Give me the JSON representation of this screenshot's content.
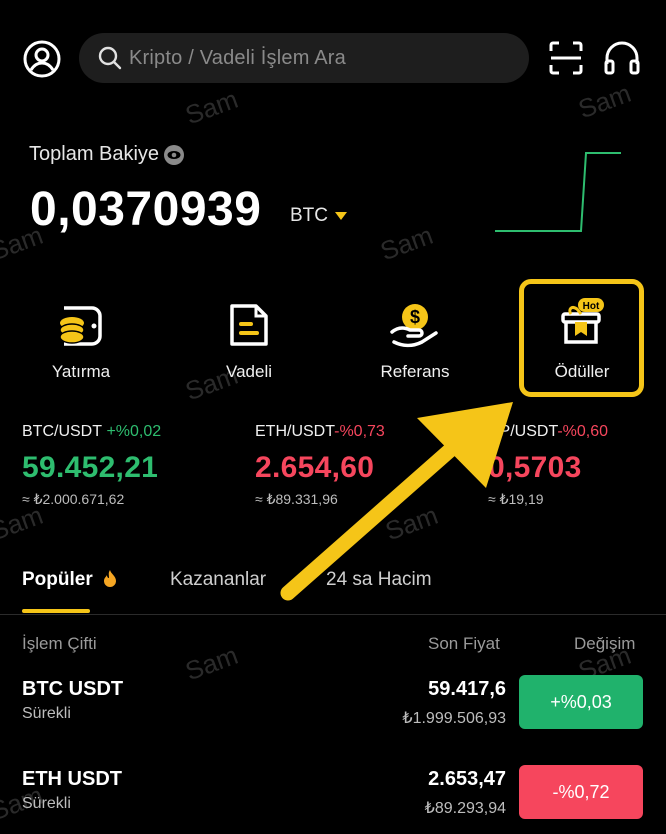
{
  "search": {
    "placeholder": "Kripto / Vadeli İşlem Ara"
  },
  "balance": {
    "label": "Toplam Bakiye",
    "value": "0,0370939",
    "unit": "BTC"
  },
  "watermark": "Sam",
  "actions": [
    {
      "label": "Yatırma",
      "icon": "deposit-wallet-icon"
    },
    {
      "label": "Vadeli",
      "icon": "futures-document-icon"
    },
    {
      "label": "Referans",
      "icon": "referral-hand-coin-icon"
    },
    {
      "label": "Ödüller",
      "icon": "rewards-gift-icon",
      "badge": "Hot"
    }
  ],
  "tickers": [
    {
      "pair": "BTC/USDT",
      "change": "+%0,02",
      "price": "59.452,21",
      "fiat": "≈ ₺2.000.671,62"
    },
    {
      "pair": "ETH/USDT",
      "change": "-%0,73",
      "price": "2.654,60",
      "fiat": "≈ ₺89.331,96"
    },
    {
      "pair": "RP/USDT",
      "change": "-%0,60",
      "price": "0,5703",
      "fiat": "≈ ₺19,19"
    }
  ],
  "tabs": {
    "popular": "Popüler",
    "gainers": "Kazananlar",
    "volume": "24 sa Hacim"
  },
  "table": {
    "headers": {
      "pair": "İşlem Çifti",
      "last": "Son Fiyat",
      "change": "Değişim"
    },
    "rows": [
      {
        "symbol": "BTC USDT",
        "type": "Sürekli",
        "last": "59.417,6",
        "fiat": "₺1.999.506,93",
        "change": "+%0,03"
      },
      {
        "symbol": "ETH USDT",
        "type": "Sürekli",
        "last": "2.653,47",
        "fiat": "₺89.293,94",
        "change": "-%0,72"
      }
    ]
  },
  "colors": {
    "accent": "#f5c518",
    "up": "#2ebd6f",
    "down": "#f6465d",
    "background": "#000000"
  }
}
